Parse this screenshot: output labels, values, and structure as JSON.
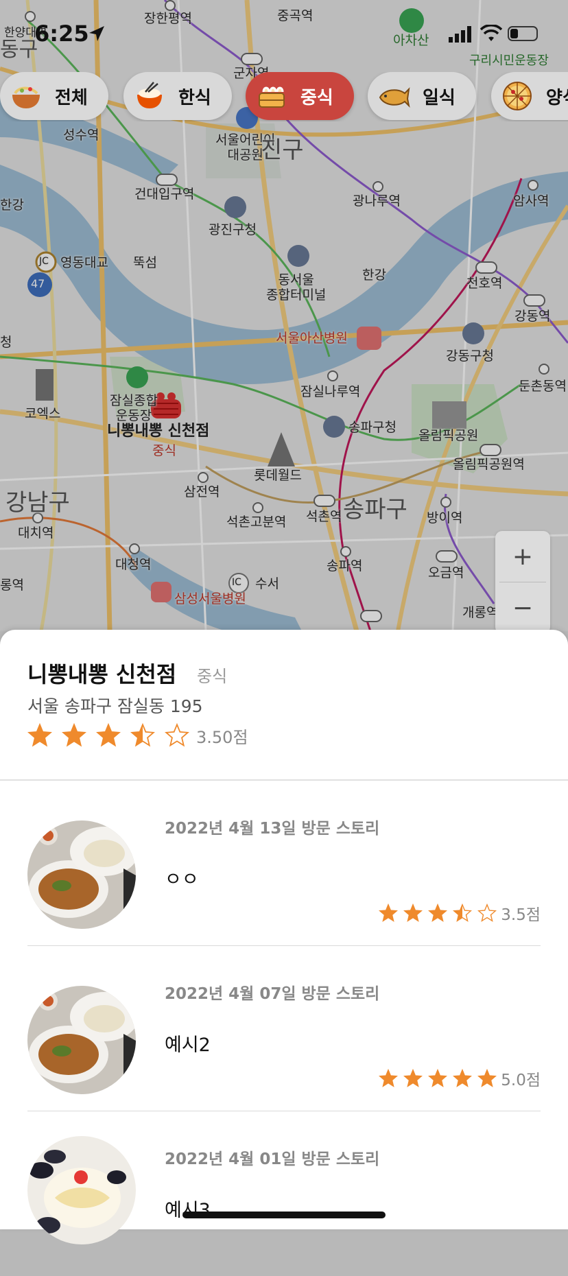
{
  "status_bar": {
    "time": "6:25",
    "battery_level": 0.3
  },
  "map": {
    "labels": {
      "janghanpyeong": "장한평역",
      "junggok": "중곡역",
      "achasan": "아차산",
      "guri": "구리시민운동장",
      "hanyang": "한양대역",
      "donggu": "동구",
      "gunja": "군자역",
      "seongsu": "성수역",
      "childpark": "서울어린이\n대공원",
      "gwangjin_gu": "진구",
      "konkuk": "건대입구역",
      "gwangnaru": "광나루역",
      "amsa": "암사역",
      "gwangjin_office": "광진구청",
      "hangang_left": "한강",
      "yeongdong_br": "영동대교",
      "ttukseom": "뚝섬",
      "dong_terminal": "동서울\n종합터미널",
      "hangang": "한강",
      "cheonho": "천호역",
      "gangdong": "강동역",
      "asan": "서울아산병원",
      "gangdong_office": "강동구청",
      "dunchon": "둔촌동역",
      "coex": "코엑스",
      "jamsil_sports": "잠실종합\n운동장",
      "jamsilnaru": "잠실나루역",
      "songpa_office": "송파구청",
      "olympic_park": "올림픽공원",
      "olympic_station": "올림픽공원역",
      "restaurant_name": "니뽕내뽕 신천점",
      "restaurant_cat": "중식",
      "lotteworld": "롯데월드",
      "samjeon": "삼전역",
      "seokchon": "석촌역",
      "songpagu": "송파구",
      "bangi": "방이역",
      "gangnamgu": "강남구",
      "daechi": "대치역",
      "seokchongobun": "석촌고분역",
      "songpa_st": "송파역",
      "ogeum": "오금역",
      "daecheong": "대청역",
      "suseo": "수서",
      "samsung": "삼성서울병원",
      "gaerong": "개롱역",
      "yeok": "롱역",
      "cheong": "청",
      "ic": "IC",
      "jc": "JC",
      "n47": "47"
    }
  },
  "categories": [
    {
      "label": "전체",
      "icon": "noodle-bowl-icon",
      "selected": false
    },
    {
      "label": "한식",
      "icon": "rice-bowl-icon",
      "selected": false
    },
    {
      "label": "중식",
      "icon": "dumpling-steamer-icon",
      "selected": true
    },
    {
      "label": "일식",
      "icon": "fish-bread-icon",
      "selected": false
    },
    {
      "label": "양식",
      "icon": "pizza-icon",
      "selected": false
    }
  ],
  "zoom": {
    "in": "+",
    "out": "−"
  },
  "place": {
    "name": "니뽕내뽕 신천점",
    "category": "중식",
    "address": "서울 송파구 잠실동 195",
    "rating": 3.5,
    "rating_text": "3.50점"
  },
  "reviews": [
    {
      "date": "2022년 4월 13일 방문 스토리",
      "text": "ㅇㅇ",
      "rating": 3.5,
      "rating_text": "3.5점"
    },
    {
      "date": "2022년 4월 07일 방문 스토리",
      "text": "예시2",
      "rating": 5.0,
      "rating_text": "5.0점"
    },
    {
      "date": "2022년 4월 01일 방문 스토리",
      "text": "예시3",
      "rating": 0,
      "rating_text": ""
    }
  ],
  "colors": {
    "accent": "#c9453e",
    "star": "#ef8a2c"
  }
}
